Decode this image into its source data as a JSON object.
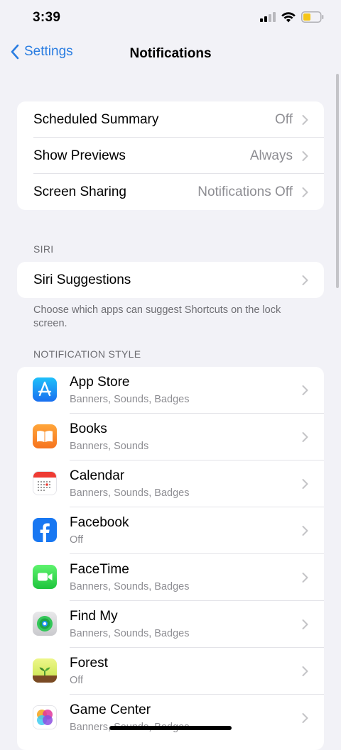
{
  "status": {
    "time": "3:39"
  },
  "nav": {
    "back_label": "Settings",
    "title": "Notifications"
  },
  "general": [
    {
      "label": "Scheduled Summary",
      "value": "Off"
    },
    {
      "label": "Show Previews",
      "value": "Always"
    },
    {
      "label": "Screen Sharing",
      "value": "Notifications Off"
    }
  ],
  "siri": {
    "header": "SIRI",
    "item_label": "Siri Suggestions",
    "footer": "Choose which apps can suggest Shortcuts on the lock screen."
  },
  "notification_style": {
    "header": "NOTIFICATION STYLE",
    "apps": [
      {
        "name": "App Store",
        "detail": "Banners, Sounds, Badges",
        "icon": "app-store-icon"
      },
      {
        "name": "Books",
        "detail": "Banners, Sounds",
        "icon": "books-icon"
      },
      {
        "name": "Calendar",
        "detail": "Banners, Sounds, Badges",
        "icon": "calendar-icon"
      },
      {
        "name": "Facebook",
        "detail": "Off",
        "icon": "facebook-icon"
      },
      {
        "name": "FaceTime",
        "detail": "Banners, Sounds, Badges",
        "icon": "facetime-icon"
      },
      {
        "name": "Find My",
        "detail": "Banners, Sounds, Badges",
        "icon": "find-my-icon"
      },
      {
        "name": "Forest",
        "detail": "Off",
        "icon": "forest-icon"
      },
      {
        "name": "Game Center",
        "detail": "Banners, Sounds, Badges",
        "icon": "game-center-icon"
      }
    ]
  },
  "colors": {
    "accent": "#2a7de1",
    "background": "#f2f2f7",
    "secondary_text": "#8e8e93"
  }
}
